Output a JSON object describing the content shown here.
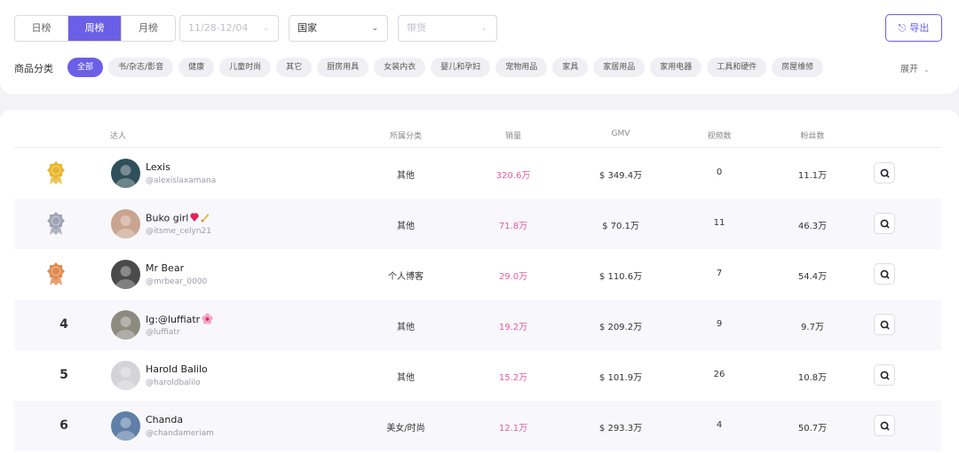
{
  "tabs": [
    "日榜",
    "周榜",
    "月榜"
  ],
  "active_tab": 1,
  "date_select": "11/28-12/04",
  "country_select": "国家",
  "sell_select": "带货",
  "export_label": "导出",
  "category": {
    "label": "商品分类",
    "items": [
      "全部",
      "书/杂志/影音",
      "健康",
      "儿童时尚",
      "其它",
      "厨房用具",
      "女装内衣",
      "婴儿和孕妇",
      "宠物用品",
      "家具",
      "家居用品",
      "家用电器",
      "工具和硬件",
      "房屋维修"
    ],
    "active": 0,
    "expand_label": "展开"
  },
  "table": {
    "headers": {
      "creator": "达人",
      "category": "所属分类",
      "sales": "销量",
      "gmv": "GMV",
      "videos": "视频数",
      "fans": "粉丝数"
    },
    "rows": [
      {
        "rank": "1",
        "medal": "gold",
        "name": "Lexis",
        "handle": "@alexislaxamana",
        "category": "其他",
        "sales": "320.6万",
        "gmv": "$ 349.4万",
        "videos": "0",
        "fans": "11.1万",
        "avatar": "#2f4f5a"
      },
      {
        "rank": "2",
        "medal": "silver",
        "name": "Buko girl",
        "handle": "@itsme_celyn21",
        "category": "其他",
        "sales": "71.8万",
        "gmv": "$ 70.1万",
        "videos": "11",
        "fans": "46.3万",
        "avatar": "#c9a48e"
      },
      {
        "rank": "3",
        "medal": "bronze",
        "name": "Mr Bear",
        "handle": "@mrbear_0000",
        "category": "个人博客",
        "sales": "29.0万",
        "gmv": "$ 110.6万",
        "videos": "7",
        "fans": "54.4万",
        "avatar": "#4a4a4a"
      },
      {
        "rank": "4",
        "medal": "",
        "name": "Ig:@luffiatr",
        "handle": "@luffiatr",
        "category": "其他",
        "sales": "19.2万",
        "gmv": "$ 209.2万",
        "videos": "9",
        "fans": "9.7万",
        "avatar": "#8d8a80"
      },
      {
        "rank": "5",
        "medal": "",
        "name": "Harold Balilo",
        "handle": "@haroldbalilo",
        "category": "其他",
        "sales": "15.2万",
        "gmv": "$ 101.9万",
        "videos": "26",
        "fans": "10.8万",
        "avatar": "#d3d3d8"
      },
      {
        "rank": "6",
        "medal": "",
        "name": "Chanda",
        "handle": "@chandameriam",
        "category": "美女/时尚",
        "sales": "12.1万",
        "gmv": "$ 293.3万",
        "videos": "4",
        "fans": "50.7万",
        "avatar": "#5f7fa8"
      }
    ]
  },
  "colors": {
    "accent": "#6b5fe8",
    "sales": "#e85aa0",
    "gold": "#e8b52c",
    "silver": "#9ea3b4",
    "bronze": "#e08a4e"
  }
}
